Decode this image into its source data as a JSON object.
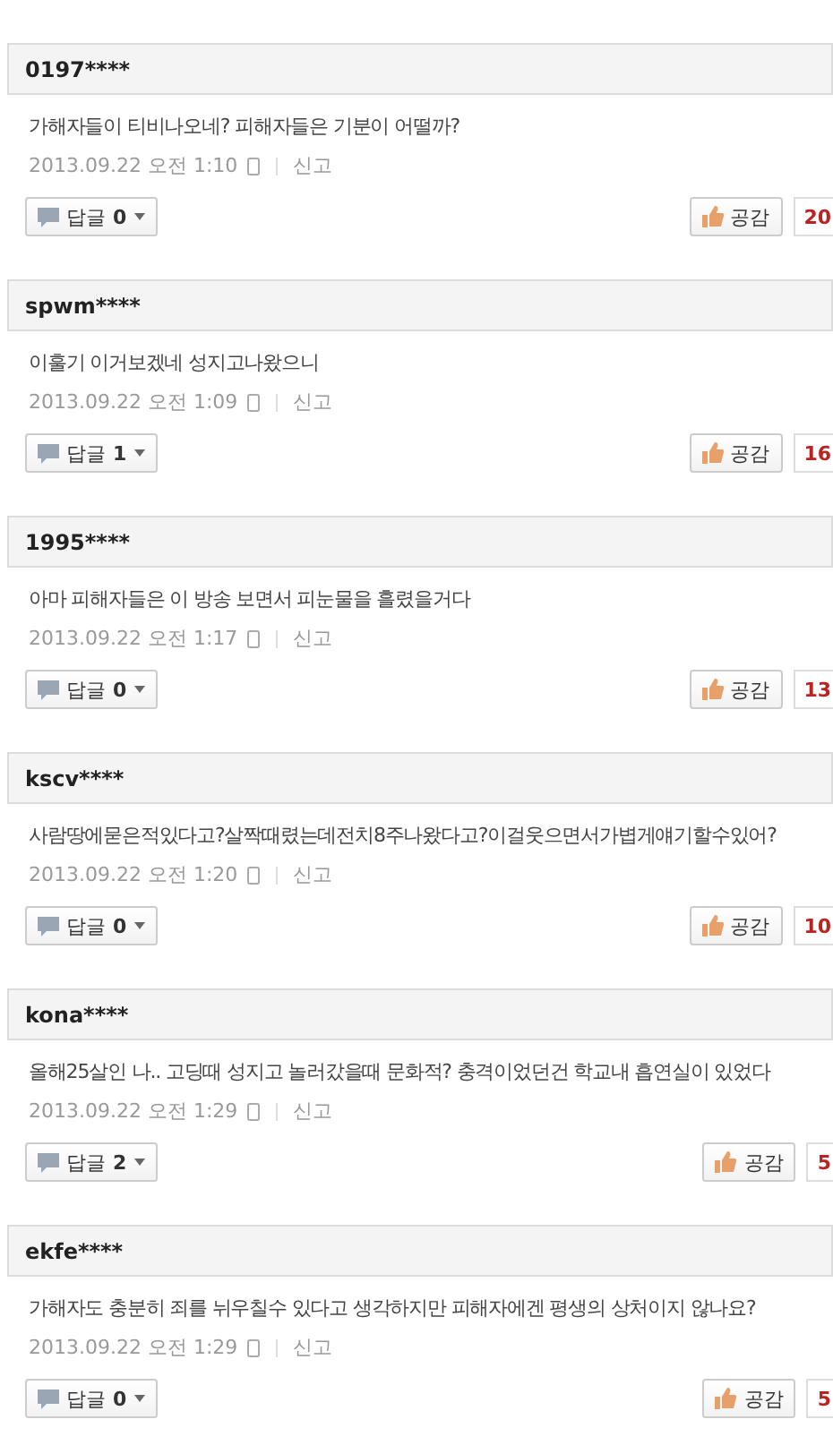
{
  "comments": [
    {
      "user": "0197****",
      "text": "가해자들이 티비나오네? 피해자들은 기분이 어떨까?",
      "date": "2013.09.22 오전 1:10",
      "report": "신고",
      "reply_label": "답글",
      "reply_count": "0",
      "like_label": "공감",
      "like_count": "20"
    },
    {
      "user": "spwm****",
      "text": "이훌기 이거보겠네 성지고나왔으니",
      "date": "2013.09.22 오전 1:09",
      "report": "신고",
      "reply_label": "답글",
      "reply_count": "1",
      "like_label": "공감",
      "like_count": "16"
    },
    {
      "user": "1995****",
      "text": "아마 피해자들은 이 방송 보면서 피눈물을 흘렸을거다",
      "date": "2013.09.22 오전 1:17",
      "report": "신고",
      "reply_label": "답글",
      "reply_count": "0",
      "like_label": "공감",
      "like_count": "13"
    },
    {
      "user": "kscv****",
      "text": "사람땅에묻은적있다고?살짝때렸는데전치8주나왔다고?이걸웃으면서가볍게얘기할수있어?",
      "date": "2013.09.22 오전 1:20",
      "report": "신고",
      "reply_label": "답글",
      "reply_count": "0",
      "like_label": "공감",
      "like_count": "10"
    },
    {
      "user": "kona****",
      "text": "올해25살인 나.. 고딩때 성지고 놀러갔을때 문화적? 충격이었던건 학교내 흡연실이 있었다",
      "date": "2013.09.22 오전 1:29",
      "report": "신고",
      "reply_label": "답글",
      "reply_count": "2",
      "like_label": "공감",
      "like_count": "5"
    },
    {
      "user": "ekfe****",
      "text": "가해자도 충분히 죄를 뉘우칠수 있다고 생각하지만 피해자에겐 평생의 상처이지 않나요?",
      "date": "2013.09.22 오전 1:29",
      "report": "신고",
      "reply_label": "답글",
      "reply_count": "0",
      "like_label": "공감",
      "like_count": "5"
    }
  ]
}
